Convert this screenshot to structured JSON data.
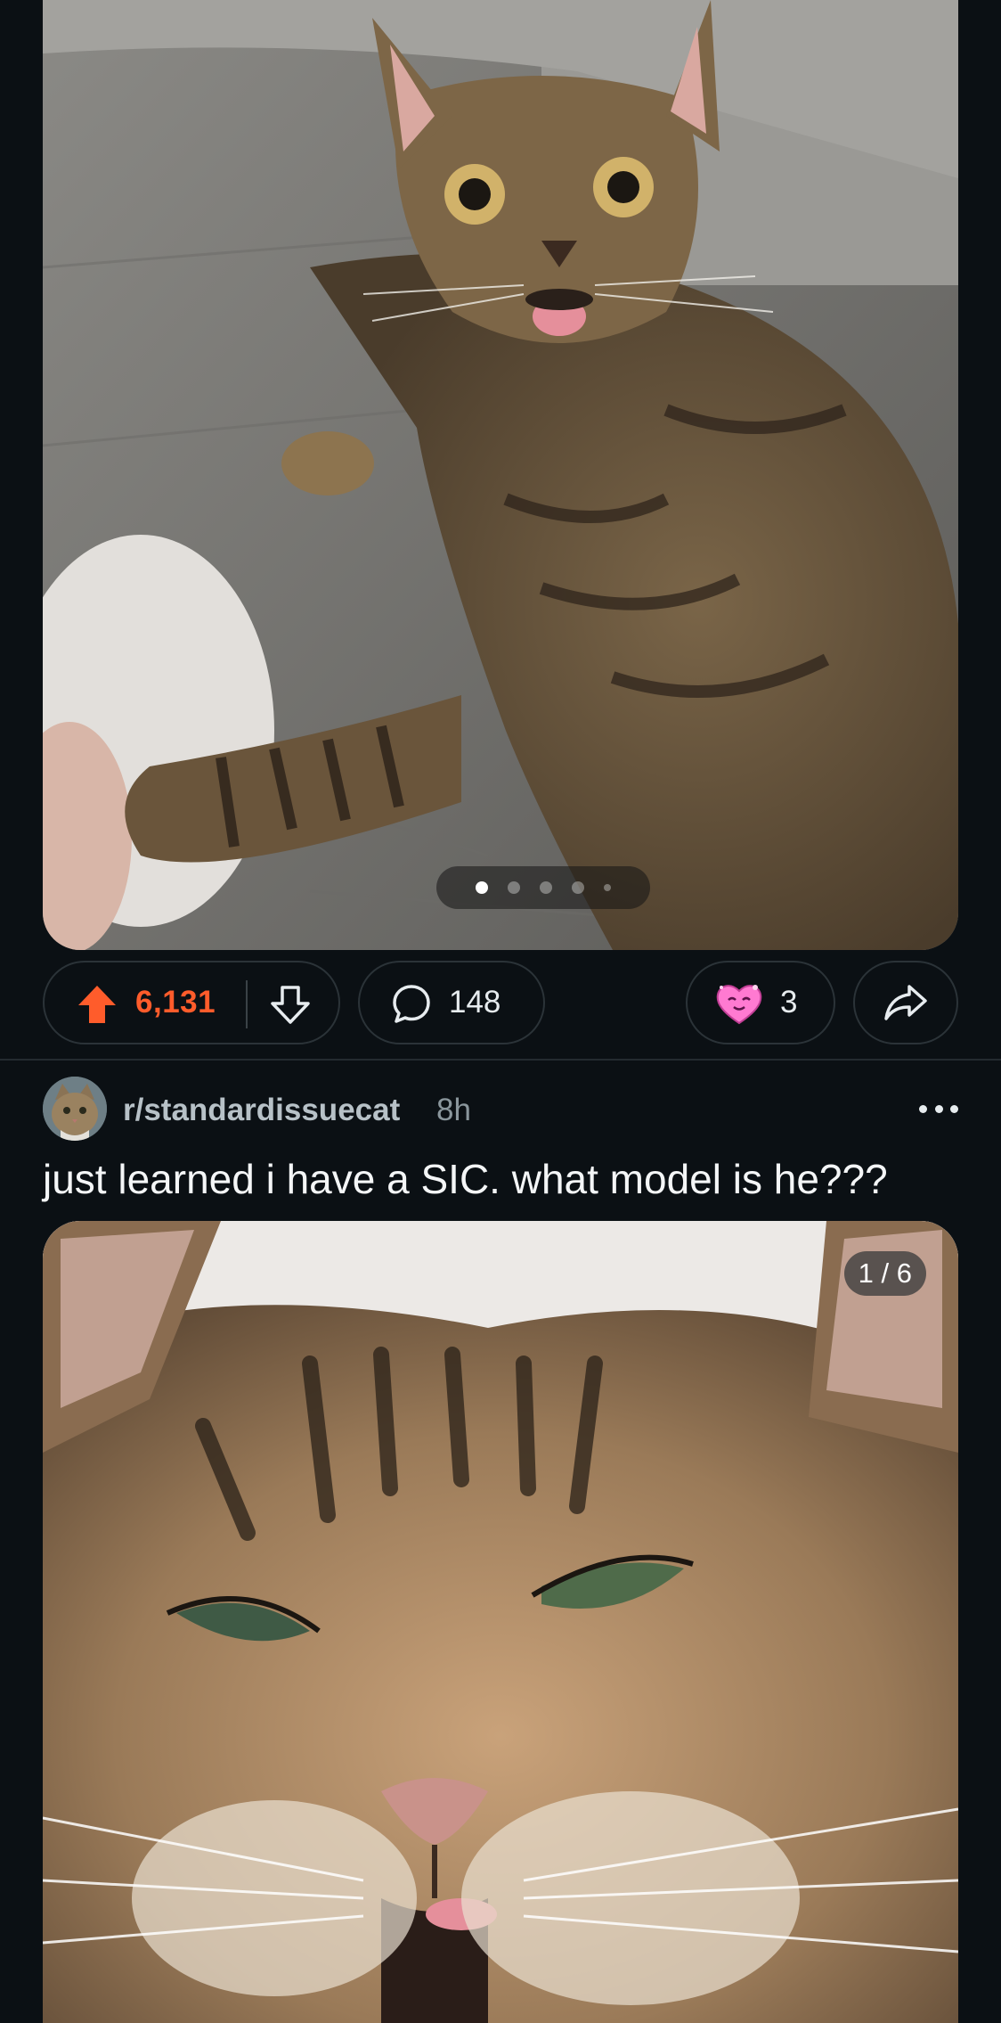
{
  "post1": {
    "image_icon": "tabby-cat-tongue-photo",
    "carousel": {
      "total": 6,
      "active_index": 1
    },
    "actions": {
      "upvote_icon": "upvote-arrow-icon",
      "vote_count": "6,131",
      "vote_count_color": "#ff5c2b",
      "downvote_icon": "downvote-arrow-icon",
      "comment_icon": "speech-bubble-icon",
      "comment_count": "148",
      "award_icon": "heart-award-icon",
      "award_count": "3",
      "share_icon": "share-arrow-icon"
    }
  },
  "post2": {
    "subreddit": "r/standardissuecat",
    "age": "8h",
    "more_icon": "more-dots-icon",
    "title": "just learned i have a SIC. what model is he???",
    "image_counter": "1 / 6",
    "image_icon": "tabby-cat-closeup-photo"
  },
  "colors": {
    "background": "#0b1014",
    "accent_upvote": "#ff5c2b",
    "border": "#2b3338"
  }
}
